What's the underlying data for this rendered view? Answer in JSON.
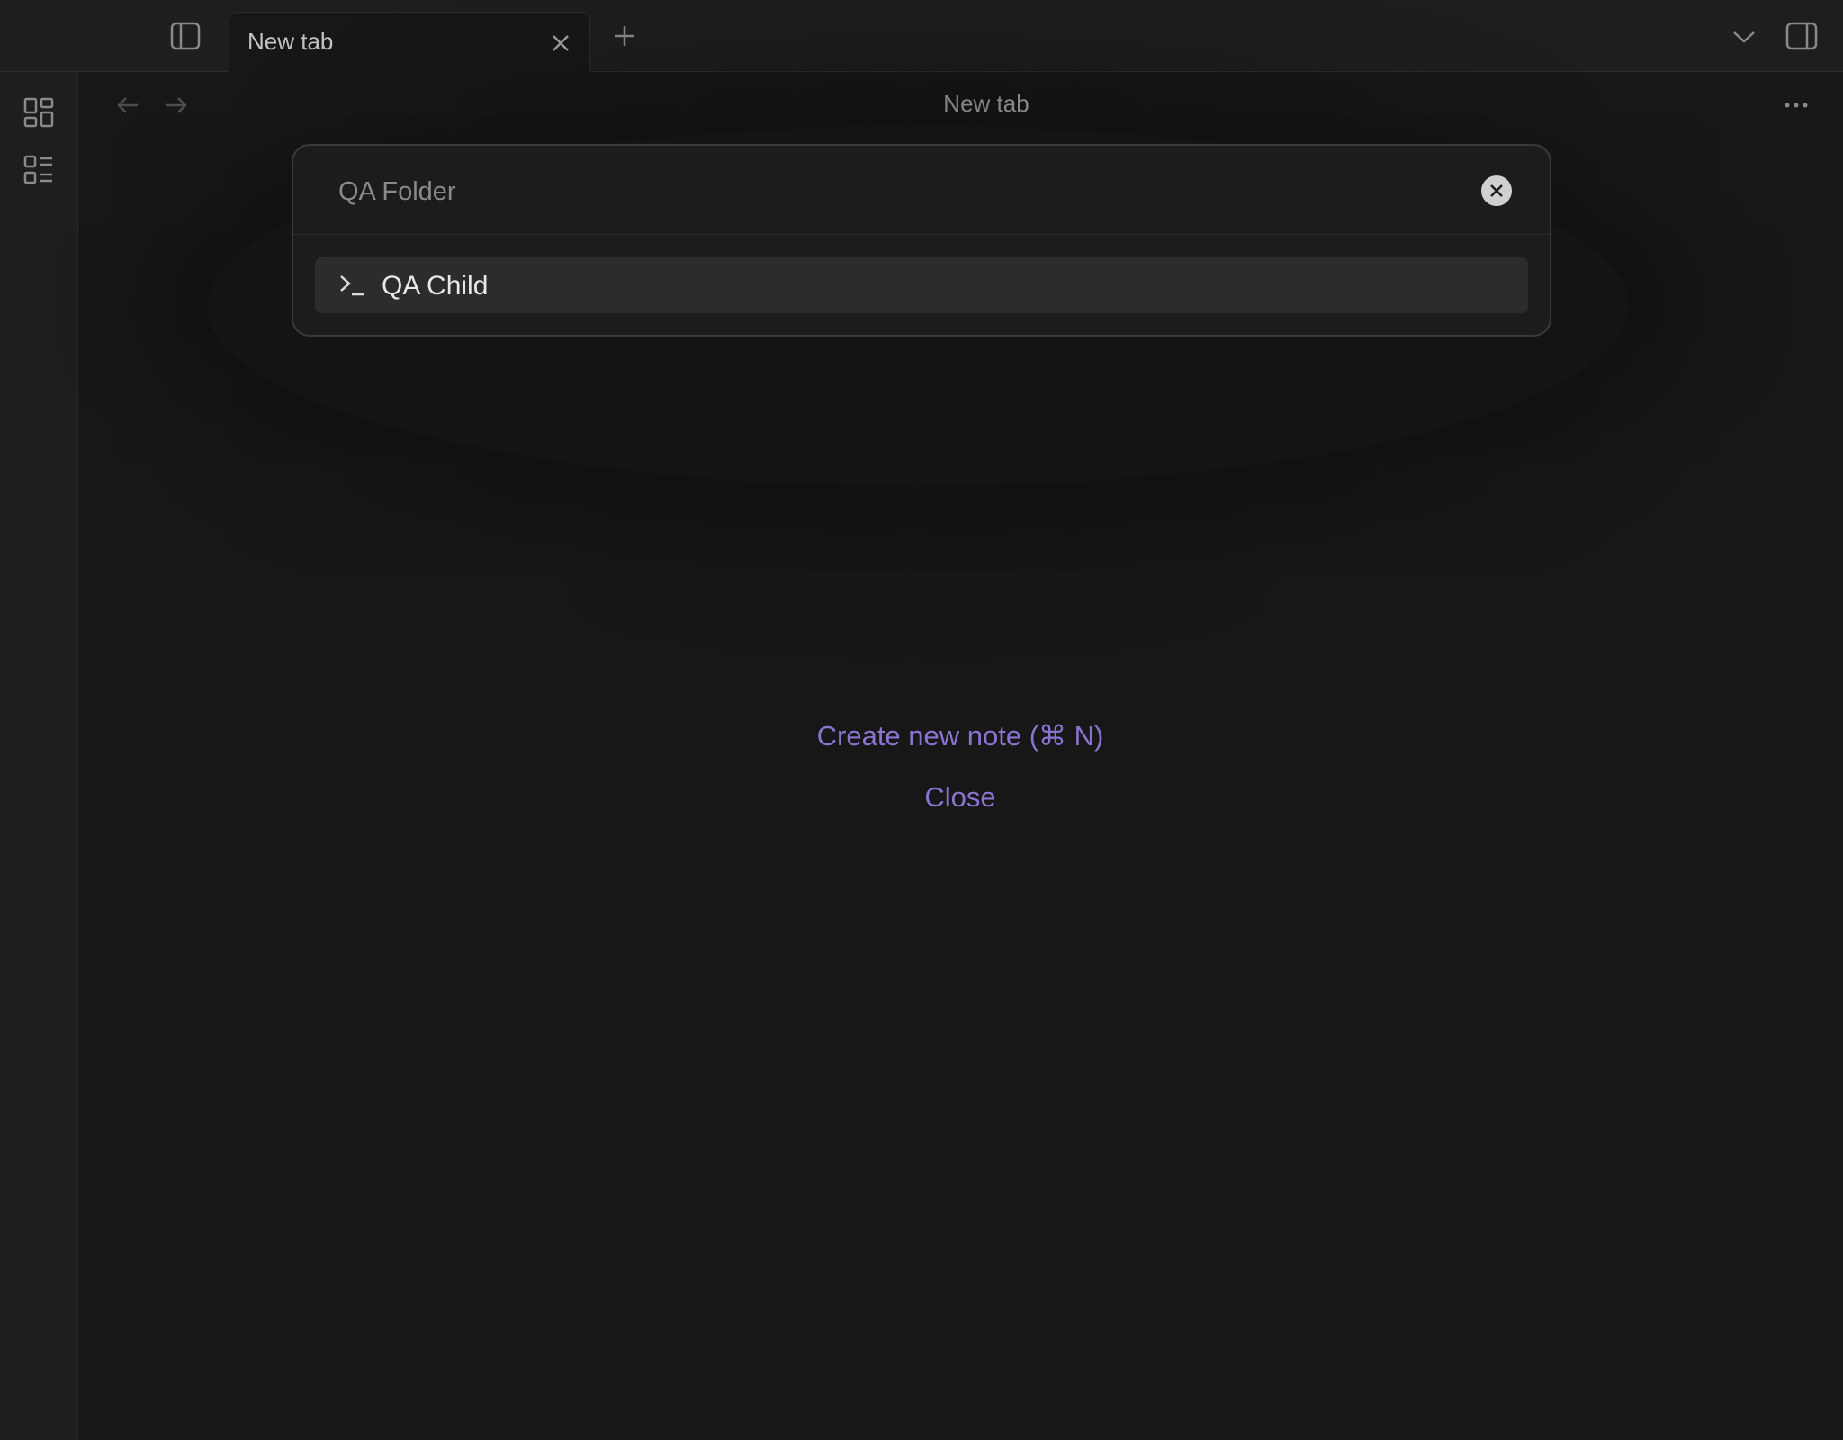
{
  "tabbar": {
    "active_tab": {
      "label": "New tab"
    }
  },
  "view_header": {
    "title": "New tab"
  },
  "quick_switcher": {
    "query": "",
    "placeholder": "QA Folder",
    "suggestions": [
      {
        "label": "QA Child",
        "icon": "terminal-icon"
      }
    ]
  },
  "empty_state": {
    "create_note_label": "Create new note (⌘ N)",
    "close_label": "Close"
  },
  "colors": {
    "background": "#171717",
    "accent": "#8b74d1",
    "selection": "#2c2c2c"
  }
}
